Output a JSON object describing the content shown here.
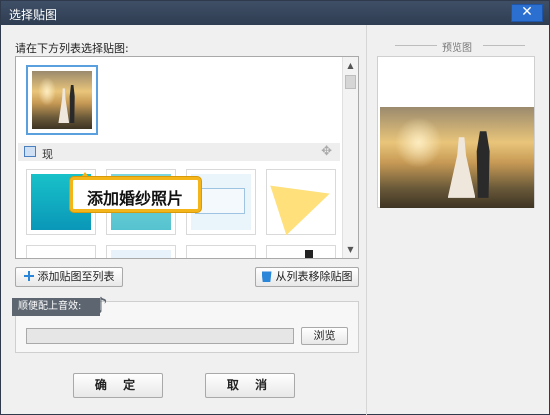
{
  "window": {
    "title": "选择贴图",
    "close_glyph": "✕"
  },
  "list": {
    "prompt": "请在下方列表选择贴图:",
    "group_label": "现",
    "callout_text": "添加婚纱照片"
  },
  "buttons": {
    "add_label": "添加贴图至列表",
    "remove_label": "从列表移除贴图",
    "browse_label": "浏览",
    "ok_label": "确 定",
    "cancel_label": "取 消"
  },
  "music": {
    "section_label": "顺便配上音效:",
    "file_value": ""
  },
  "preview": {
    "label": "预览图"
  },
  "icons": [
    "close-icon",
    "image-icon",
    "move-icon",
    "plus-icon",
    "trash-icon",
    "music-note-icon",
    "scroll-up-icon",
    "scroll-down-icon"
  ],
  "colors": {
    "title_bar": "#34445a",
    "accent": "#2a86d8",
    "callout_border": "#f3b51a",
    "selection": "#5aa0de"
  }
}
